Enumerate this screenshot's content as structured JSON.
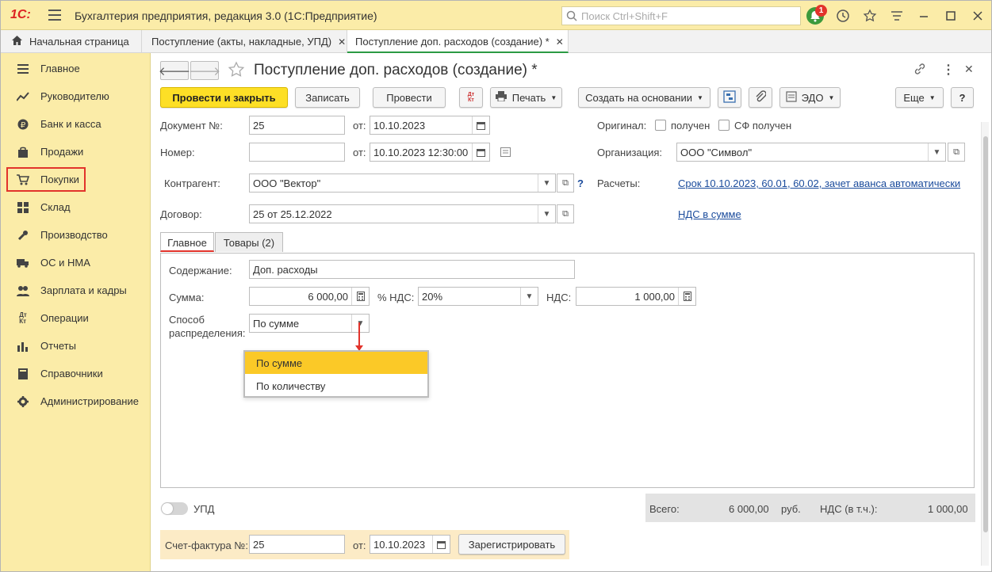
{
  "app": {
    "logo": "1С:",
    "title": "Бухгалтерия предприятия, редакция 3.0  (1С:Предприятие)",
    "search_placeholder": "Поиск Ctrl+Shift+F",
    "notifications_count": "1"
  },
  "tabs": [
    {
      "label": "Начальная страница"
    },
    {
      "label": "Поступление (акты, накладные, УПД)"
    },
    {
      "label": "Поступление доп. расходов (создание) *"
    }
  ],
  "sidebar": {
    "items": [
      {
        "label": "Главное",
        "icon": "menu-icon"
      },
      {
        "label": "Руководителю",
        "icon": "chart-line-icon"
      },
      {
        "label": "Банк и касса",
        "icon": "ruble-icon"
      },
      {
        "label": "Продажи",
        "icon": "bag-icon"
      },
      {
        "label": "Покупки",
        "icon": "cart-icon"
      },
      {
        "label": "Склад",
        "icon": "warehouse-icon"
      },
      {
        "label": "Производство",
        "icon": "wrench-icon"
      },
      {
        "label": "ОС и НМА",
        "icon": "truck-icon"
      },
      {
        "label": "Зарплата и кадры",
        "icon": "people-icon"
      },
      {
        "label": "Операции",
        "icon": "dt-kt-icon"
      },
      {
        "label": "Отчеты",
        "icon": "bar-chart-icon"
      },
      {
        "label": "Справочники",
        "icon": "book-icon"
      },
      {
        "label": "Администрирование",
        "icon": "gear-icon"
      }
    ]
  },
  "form": {
    "title": "Поступление доп. расходов (создание) *",
    "toolbar": {
      "post_close": "Провести и закрыть",
      "save": "Записать",
      "post": "Провести",
      "dtkt": "Дт\nКт",
      "print": "Печать",
      "create_based": "Создать на основании",
      "edo": "ЭДО",
      "more": "Еще",
      "help": "?"
    },
    "doc_no_label": "Документ №:",
    "doc_no": "25",
    "from_label": "от:",
    "doc_date": "10.10.2023",
    "number_label": "Номер:",
    "number": "",
    "from_label2": "от:",
    "doc_datetime": "10.10.2023 12:30:00",
    "original_label": "Оригинал:",
    "received_label": "получен",
    "sf_received_label": "СФ получен",
    "org_label": "Организация:",
    "org": "ООО \"Символ\"",
    "contractor_label": "Контрагент:",
    "contractor": "ООО \"Вектор\"",
    "q_mark": "?",
    "settlements_label": "Расчеты:",
    "settlements_link": "Срок 10.10.2023, 60.01, 60.02, зачет аванса автоматически",
    "contract_label": "Договор:",
    "contract": "25 от 25.12.2022",
    "vat_link": "НДС в сумме"
  },
  "inner_tabs": [
    {
      "label": "Главное"
    },
    {
      "label": "Товары (2)"
    }
  ],
  "main_tab": {
    "content_label": "Содержание:",
    "content": "Доп. расходы",
    "sum_label": "Сумма:",
    "sum": "6 000,00",
    "vat_rate_label": "% НДС:",
    "vat_rate": "20%",
    "vat_label": "НДС:",
    "vat": "1 000,00",
    "distribution_label_1": "Способ",
    "distribution_label_2": "распределения:",
    "distribution": "По сумме",
    "dropdown_options": [
      "По сумме",
      "По количеству"
    ]
  },
  "footer": {
    "upd_label": "УПД",
    "total_label": "Всего:",
    "total": "6 000,00",
    "currency": "руб.",
    "vat_incl_label": "НДС (в т.ч.):",
    "vat_incl": "1 000,00",
    "invoice_label": "Счет-фактура №:",
    "invoice_no": "25",
    "invoice_from_label": "от:",
    "invoice_date": "10.10.2023",
    "register_button": "Зарегистрировать"
  },
  "colors": {
    "accent_yellow": "#fddf26",
    "sidebar_bg": "#fbeca8",
    "highlight_red": "#e2332b",
    "dropdown_selected": "#fbc927",
    "link_blue": "#1a4b9c"
  }
}
